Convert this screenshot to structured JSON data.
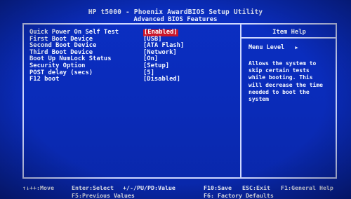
{
  "header": {
    "title": "HP t5000 - Phoenix AwardBIOS Setup Utility",
    "subtitle": "Advanced BIOS Features"
  },
  "options": [
    {
      "label": "Quick Power On Self Test",
      "value": "[Enabled]",
      "selected": true
    },
    {
      "label": "First Boot Device",
      "value": "[USB]"
    },
    {
      "label": "Second Boot Device",
      "value": "[ATA Flash]"
    },
    {
      "label": "Third Boot Device",
      "value": "[Network]"
    },
    {
      "label": "Boot Up NumLock Status",
      "value": "[On]"
    },
    {
      "label": "Security Option",
      "value": "[Setup]"
    },
    {
      "label": "POST delay (secs)",
      "value": "[5]"
    },
    {
      "label": "F12 boot",
      "value": "[Disabled]"
    }
  ],
  "help": {
    "title": "Item Help",
    "menu_level": "Menu Level",
    "menu_level_icon": "right-triangle-icon",
    "text_lines": [
      "Allows the system to",
      "skip certain tests",
      "while booting. This",
      "will decrease the time",
      "needed to boot the",
      "system"
    ]
  },
  "footer": {
    "move": "↑↓++:Move",
    "select": "Enter:Select",
    "value": "+/-/PU/PD:Value",
    "save": "F10:Save",
    "exit": "ESC:Exit",
    "general_help": "F1:General Help",
    "previous": "F5:Previous Values",
    "defaults": "F6: Factory Defaults"
  },
  "colors": {
    "background": "#0a2bb8",
    "text": "#f2f6ff",
    "highlight": "#c9162b"
  }
}
